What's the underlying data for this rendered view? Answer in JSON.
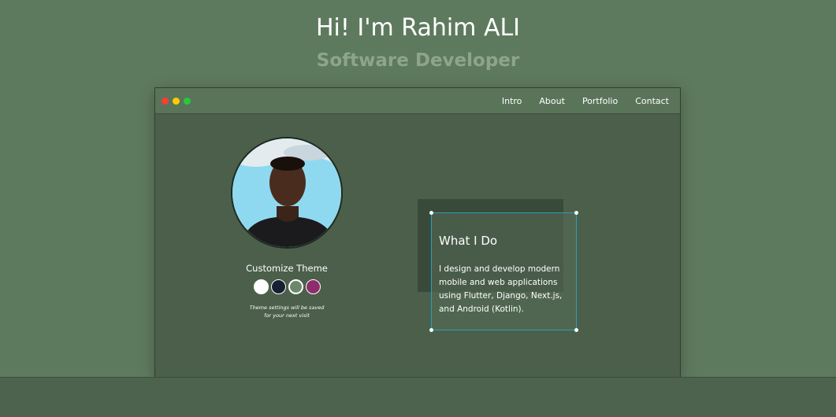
{
  "hero": {
    "title": "Hi! I'm Rahim ALI",
    "subtitle": "Software Developer"
  },
  "nav": {
    "items": [
      "Intro",
      "About",
      "Portfolio",
      "Contact"
    ]
  },
  "window_controls": {
    "red": "#ff3b30",
    "yellow": "#ffcc00",
    "green": "#28c840"
  },
  "theme": {
    "title": "Customize Theme",
    "swatches": [
      {
        "name": "white",
        "color": "#ffffff"
      },
      {
        "name": "navy",
        "color": "#162033"
      },
      {
        "name": "green",
        "color": "#5e7a5e",
        "active": true
      },
      {
        "name": "magenta",
        "color": "#8e2d6e"
      }
    ],
    "note_line1": "Theme settings will be saved",
    "note_line2": "for your next visit"
  },
  "card": {
    "title": "What I Do",
    "body": "I design and develop modern mobile and web applications using Flutter, Django, Next.js, and Android (Kotlin)."
  },
  "colors": {
    "background": "#5e7a5e",
    "accent_outline": "#2aa0b8",
    "subtitle": "#8ea48e"
  }
}
